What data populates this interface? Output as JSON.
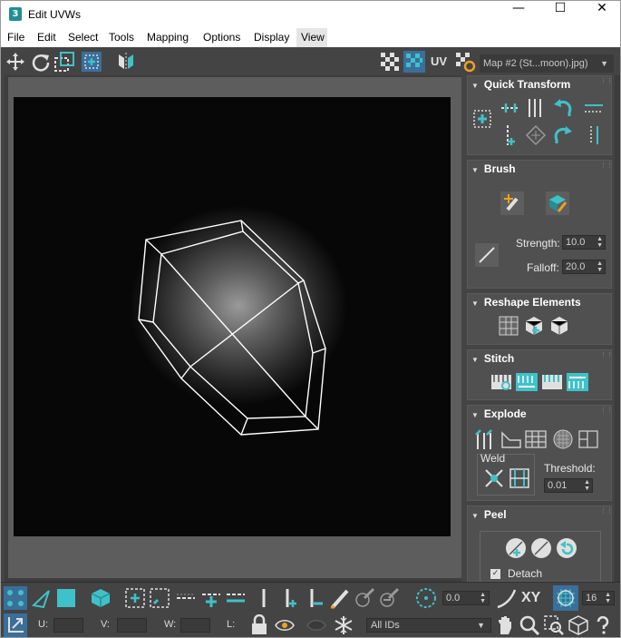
{
  "window": {
    "title": "Edit UVWs",
    "app_icon_text": "3"
  },
  "menu": [
    "File",
    "Edit",
    "Select",
    "Tools",
    "Mapping",
    "Options",
    "Display",
    "View"
  ],
  "toolbar": {
    "uv_label": "UV",
    "map_dropdown": "Map #2 (St...moon).jpg)"
  },
  "panel": {
    "quick_transform": {
      "title": "Quick Transform"
    },
    "brush": {
      "title": "Brush",
      "strength_label": "Strength:",
      "strength_value": "10.0",
      "falloff_label": "Falloff:",
      "falloff_value": "20.0"
    },
    "reshape": {
      "title": "Reshape Elements"
    },
    "stitch": {
      "title": "Stitch"
    },
    "explode": {
      "title": "Explode",
      "weld_label": "Weld",
      "threshold_label": "Threshold:",
      "threshold_value": "0.01"
    },
    "peel": {
      "title": "Peel",
      "detach_label": "Detach",
      "detach_checked": true
    }
  },
  "bottom": {
    "angle_value": "0.0",
    "xy_label": "XY",
    "grid_value": "16",
    "u_label": "U:",
    "v_label": "V:",
    "w_label": "W:",
    "l_label": "L:",
    "ids_dropdown": "All IDs"
  },
  "colors": {
    "accent": "#3fc1c9",
    "panel_bg": "#444444",
    "rollout_bg": "#505050"
  }
}
